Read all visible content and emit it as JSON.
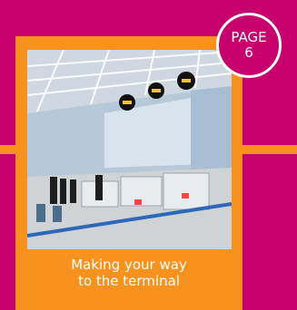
{
  "colors": {
    "background": "#c8006e",
    "accent_orange": "#f7921e",
    "card": "#f7921e",
    "badge": "#c8006e",
    "text": "#ffffff"
  },
  "badge": {
    "line1": "PAGE",
    "line2": "6"
  },
  "caption": {
    "line1": "Making your way",
    "line2": "to the terminal"
  },
  "photo": {
    "subject": "airport terminal check-in hall"
  }
}
